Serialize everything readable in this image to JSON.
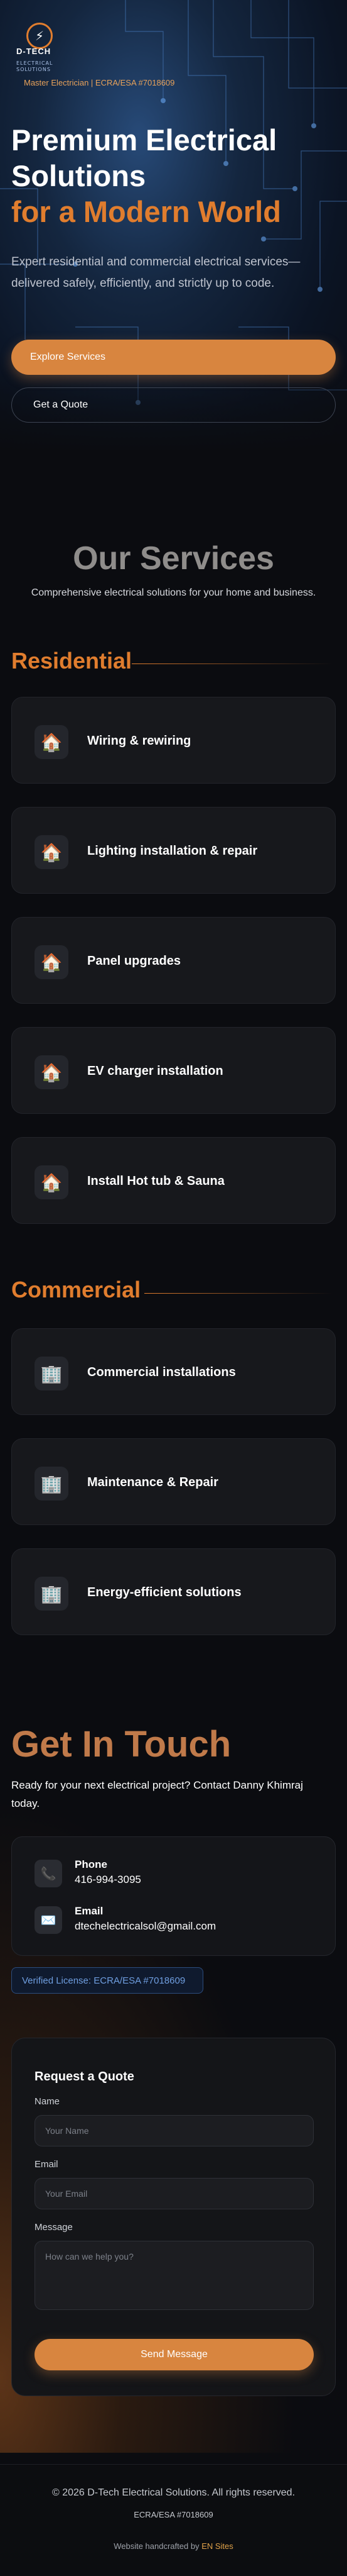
{
  "header": {
    "logo_name": "D-TECH",
    "logo_sub1": "ELECTRICAL",
    "logo_sub2": "SOLUTIONS",
    "license": "Master Electrician | ECRA/ESA #7018609"
  },
  "hero": {
    "title_line1": "Premium Electrical",
    "title_line2": "Solutions",
    "title_accent": "for a Modern World",
    "subtitle": "Expert residential and commercial electrical services—delivered safely, efficiently, and strictly up to code.",
    "primary_button": "Explore Services",
    "secondary_button": "Get a Quote"
  },
  "services": {
    "title": "Our Services",
    "subtitle": "Comprehensive electrical solutions for your home and business.",
    "residential": {
      "heading": "Residential",
      "items": [
        {
          "label": "Wiring & rewiring",
          "icon": "house-icon"
        },
        {
          "label": "Lighting installation & repair",
          "icon": "house-icon"
        },
        {
          "label": "Panel upgrades",
          "icon": "house-icon"
        },
        {
          "label": "EV charger installation",
          "icon": "house-icon"
        },
        {
          "label": "Install Hot tub & Sauna",
          "icon": "house-icon"
        }
      ]
    },
    "commercial": {
      "heading": "Commercial",
      "items": [
        {
          "label": "Commercial installations",
          "icon": "building-icon"
        },
        {
          "label": "Maintenance & Repair",
          "icon": "building-icon"
        },
        {
          "label": "Energy-efficient solutions",
          "icon": "building-icon"
        }
      ]
    }
  },
  "contact": {
    "title": "Get In Touch",
    "subtitle": "Ready for your next electrical project? Contact Danny Khimraj today.",
    "phone_label": "Phone",
    "phone_value": "416-994-3095",
    "email_label": "Email",
    "email_value": "dtechelectricalsol@gmail.com",
    "verified": "Verified License: ECRA/ESA #7018609"
  },
  "form": {
    "title": "Request a Quote",
    "name_label": "Name",
    "name_placeholder": "Your Name",
    "email_label": "Email",
    "email_placeholder": "Your Email",
    "message_label": "Message",
    "message_placeholder": "How can we help you?",
    "submit": "Send Message"
  },
  "footer": {
    "copyright": "© 2026 D-Tech Electrical Solutions. All rights reserved.",
    "license": "ECRA/ESA #7018609",
    "credit_prefix": "Website handcrafted by",
    "credit_brand": "EN Sites"
  },
  "colors": {
    "accent": "#e07d2e",
    "button": "#d8853f",
    "background": "#0b0c10",
    "card": "#17181c",
    "verified_text": "#6f9ee0"
  }
}
